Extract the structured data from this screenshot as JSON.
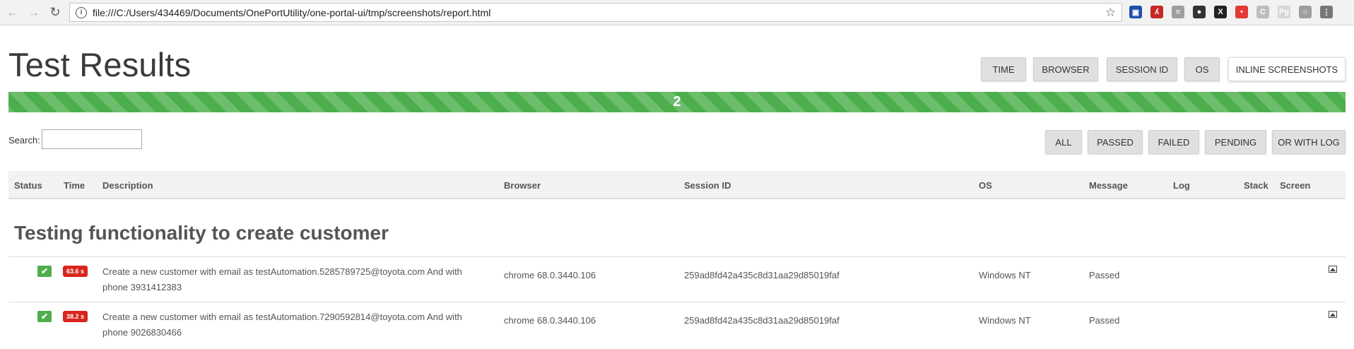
{
  "browser": {
    "url": "file:///C:/Users/434469/Documents/OnePortUtility/one-portal-ui/tmp/screenshots/report.html",
    "back_icon": "arrow-left-icon",
    "forward_icon": "arrow-right-icon",
    "reload_icon": "reload-icon",
    "info_icon": "info-icon",
    "bookmark_icon": "star-icon",
    "extensions": [
      {
        "name": "ext-blue-icon",
        "color": "#1e4ea8",
        "glyph": "▣"
      },
      {
        "name": "ext-red-icon",
        "color": "#c62828",
        "glyph": "ʎ"
      },
      {
        "name": "ext-grey-icon",
        "color": "#9e9e9e",
        "glyph": "≡"
      },
      {
        "name": "ext-dark-icon",
        "color": "#333333",
        "glyph": "●"
      },
      {
        "name": "ext-x-icon",
        "color": "#222222",
        "glyph": "X"
      },
      {
        "name": "ext-red-badge-icon",
        "color": "#e53935",
        "glyph": "•"
      },
      {
        "name": "ext-c-icon",
        "color": "#bdbdbd",
        "glyph": "C"
      },
      {
        "name": "ext-pg-icon",
        "color": "#d6d6d6",
        "glyph": "Pg"
      },
      {
        "name": "profile-icon",
        "color": "#9e9e9e",
        "glyph": "○"
      },
      {
        "name": "menu-icon",
        "color": "#777777",
        "glyph": "⋮"
      }
    ]
  },
  "page": {
    "title": "Test Results",
    "column_buttons": [
      "TIME",
      "BROWSER",
      "SESSION ID",
      "OS",
      "INLINE SCREENSHOTS"
    ],
    "progress": {
      "label": "2",
      "fraction_passed": 1.0,
      "color": "#4cae4c"
    },
    "search": {
      "label": "Search:",
      "value": ""
    },
    "filter_buttons": [
      "ALL",
      "PASSED",
      "FAILED",
      "PENDING",
      "OR WITH LOG"
    ],
    "columns": [
      "Status",
      "Time",
      "Description",
      "Browser",
      "Session ID",
      "OS",
      "Message",
      "Log",
      "Stack",
      "Screen"
    ],
    "group": "Testing functionality to create customer",
    "rows": [
      {
        "status_icon": "check-icon",
        "time": "63.6 s",
        "description": "Create a new customer with email as testAutomation.5285789725@toyota.com And with phone 3931412383",
        "browser": "chrome 68.0.3440.106",
        "session_id": "259ad8fd42a435c8d31aa29d85019faf",
        "os": "Windows NT",
        "message": "Passed",
        "screen_icon": "image-icon"
      },
      {
        "status_icon": "check-icon",
        "time": "38.2 s",
        "description": "Create a new customer with email as testAutomation.7290592814@toyota.com And with phone 9026830466",
        "browser": "chrome 68.0.3440.106",
        "session_id": "259ad8fd42a435c8d31aa29d85019faf",
        "os": "Windows NT",
        "message": "Passed",
        "screen_icon": "image-icon"
      }
    ]
  }
}
